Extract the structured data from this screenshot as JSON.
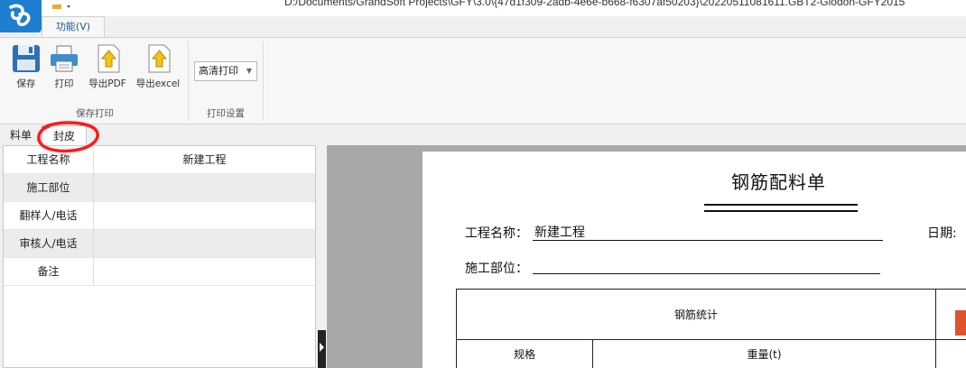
{
  "window": {
    "title": "D:/Documents/GrandSoft Projects\\GFY\\3.0\\{47d1f309-2adb-4e6e-b668-f6307af50203}\\20220511081611.GBT2-Glodon-GFY2015"
  },
  "ribbon": {
    "tab_label": "功能(V)",
    "buttons": {
      "save": "保存",
      "print": "打印",
      "export_pdf": "导出PDF",
      "export_excel": "导出excel"
    },
    "group_save_print": "保存打印",
    "group_print_settings": "打印设置",
    "quality_select": "高清打印"
  },
  "doc_tabs": [
    "料单",
    "封皮"
  ],
  "form": {
    "rows": [
      {
        "label": "工程名称",
        "value": "新建工程"
      },
      {
        "label": "施工部位",
        "value": ""
      },
      {
        "label": "翻样人/电话",
        "value": ""
      },
      {
        "label": "审核人/电话",
        "value": ""
      },
      {
        "label": "备注",
        "value": ""
      }
    ]
  },
  "preview": {
    "doc_title": "钢筋配料单",
    "project_label": "工程名称：",
    "project_value": "新建工程",
    "date_label": "日期:",
    "location_label": "施工部位：",
    "table_header": "钢筋统计",
    "col_spec": "规格",
    "col_weight": "重量(t)"
  },
  "colors": {
    "accent": "#1e7fd0",
    "annotation": "#ff0000"
  }
}
